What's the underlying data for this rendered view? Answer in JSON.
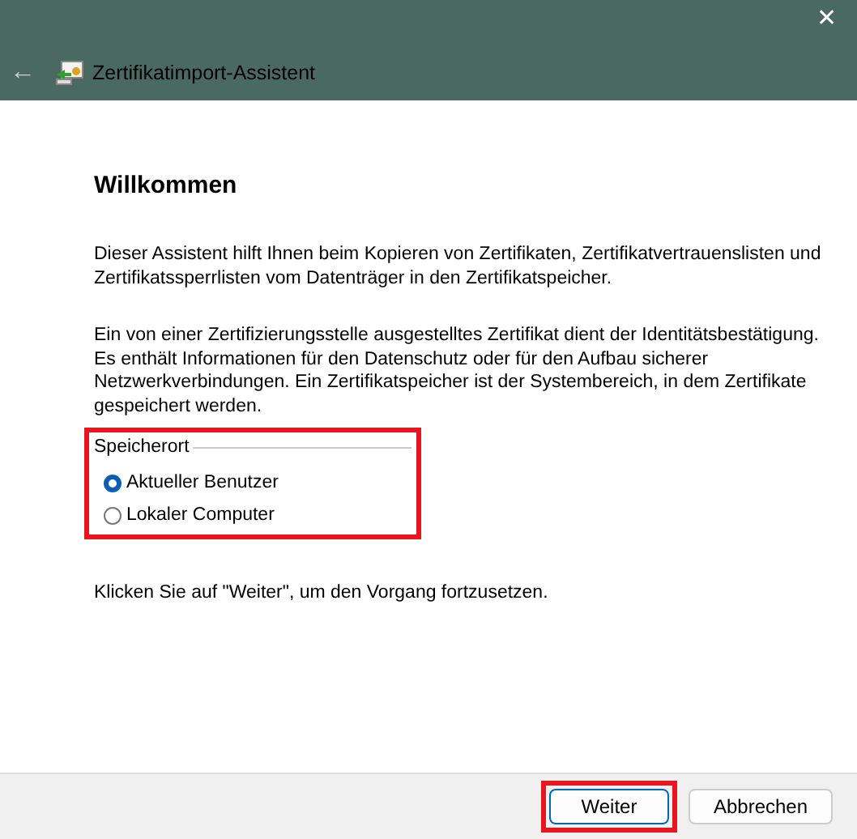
{
  "window": {
    "title": "Zertifikatimport-Assistent",
    "close": "✕",
    "back": "←"
  },
  "heading": "Willkommen",
  "paragraphs": [
    "Dieser Assistent hilft Ihnen beim Kopieren von Zertifikaten, Zertifikatvertrauenslisten und Zertifikatssperrlisten vom Datenträger in den Zertifikatspeicher.",
    "Ein von einer Zertifizierungsstelle ausgestelltes Zertifikat dient der Identitätsbestätigung. Es enthält Informationen für den Datenschutz oder für den Aufbau sicherer Netzwerkverbindungen. Ein Zertifikatspeicher ist der Systembereich, in dem Zertifikate gespeichert werden."
  ],
  "store_location": {
    "label": "Speicherort",
    "highlighted": true,
    "options": [
      {
        "label": "Aktueller Benutzer",
        "selected": true
      },
      {
        "label": "Lokaler Computer",
        "selected": false
      }
    ]
  },
  "hint": "Klicken Sie auf \"Weiter\", um den Vorgang fortzusetzen.",
  "buttons": [
    {
      "label": "Weiter",
      "highlighted": true,
      "default": true
    },
    {
      "label": "Abbrechen",
      "highlighted": false,
      "default": false
    }
  ]
}
